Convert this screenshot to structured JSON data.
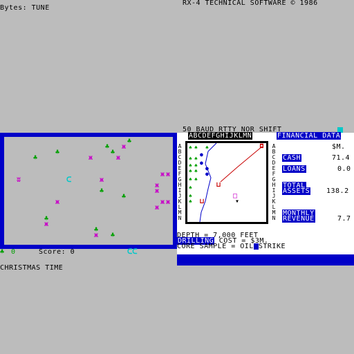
{
  "top": {
    "bytes_label": "Bytes: TUNE",
    "copyright": "RX-4 TECHNICAL SOFTWARE © 1986"
  },
  "radio": {
    "status": "50 BAUD RTTY NOR SHIFT"
  },
  "game": {
    "score_label": "Score: 0",
    "bottom_caption": "CHRISTMAS TIME",
    "lives_count": "0",
    "colors": {
      "border": "#0000c8",
      "tree": "#00a000",
      "bug": "#c800c8",
      "player": "#00c8c8"
    }
  },
  "oil": {
    "map_header": "ABCDEFGHIJKLMN",
    "row_letters": "ABCDEFGHIJKLMN",
    "financial_header": "FINANCIAL DATA",
    "unit": "$M.",
    "cash_label": "CASH",
    "cash_value": "71.4",
    "loans_label": "LOANS",
    "loans_value": "0.0",
    "total_assets_label_1": "TOTAL",
    "total_assets_label_2": "ASSETS",
    "total_assets_value": "138.2",
    "monthly_revenue_label_1": "MONTHLY",
    "monthly_revenue_label_2": "REVENUE",
    "monthly_revenue_value": "7.7",
    "depth_line": "DEPTH = 7,000 FEET",
    "drilling_label": "DRILLING",
    "drilling_cost": " COST = $3M.",
    "core_sample_prefix": "CORE SAMPLE = OIL",
    "core_sample_suffix": "STRIKE"
  }
}
